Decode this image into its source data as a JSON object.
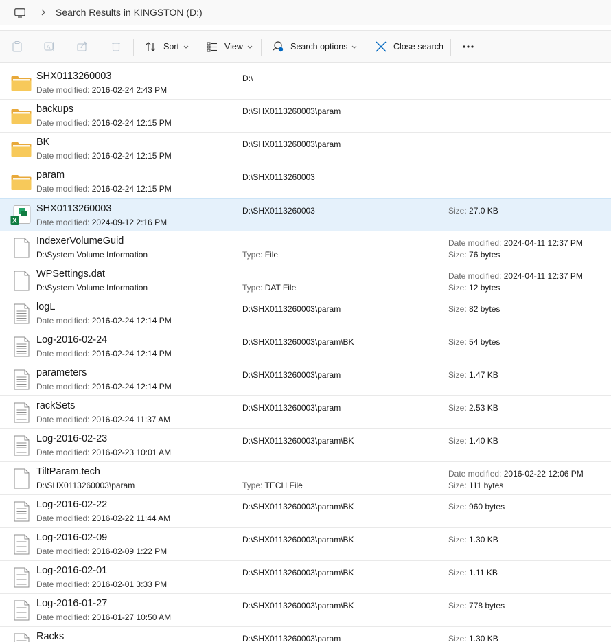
{
  "address": {
    "path": "Search Results in KINGSTON (D:)"
  },
  "toolbar": {
    "sort_label": "Sort",
    "view_label": "View",
    "search_options_label": "Search options",
    "close_search_label": "Close search",
    "more_label": "···"
  },
  "labels": {
    "date_modified": "Date modified:",
    "size": "Size:",
    "type": "Type:"
  },
  "files": [
    {
      "name": "SHX0113260003",
      "icon": "folder-icon",
      "date": "2016-02-24 2:43 PM",
      "location": "D:\\"
    },
    {
      "name": "backups",
      "icon": "folder-icon",
      "date": "2016-02-24 12:15 PM",
      "location": "D:\\SHX0113260003\\param"
    },
    {
      "name": "BK",
      "icon": "folder-icon",
      "date": "2016-02-24 12:15 PM",
      "location": "D:\\SHX0113260003\\param"
    },
    {
      "name": "param",
      "icon": "folder-icon",
      "date": "2016-02-24 12:15 PM",
      "location": "D:\\SHX0113260003"
    },
    {
      "name": "SHX0113260003",
      "icon": "excel-icon",
      "date": "2024-09-12 2:16 PM",
      "location": "D:\\SHX0113260003",
      "size": "27.0 KB",
      "selected": true
    },
    {
      "name": "IndexerVolumeGuid",
      "icon": "file-icon",
      "location": "D:\\System Volume Information",
      "type": "File",
      "date": "2024-04-11 12:37 PM",
      "size": "76 bytes"
    },
    {
      "name": "WPSettings.dat",
      "icon": "file-icon",
      "location": "D:\\System Volume Information",
      "type": "DAT File",
      "date": "2024-04-11 12:37 PM",
      "size": "12 bytes"
    },
    {
      "name": "logL",
      "icon": "text-file-icon",
      "date": "2016-02-24 12:14 PM",
      "location": "D:\\SHX0113260003\\param",
      "size": "82 bytes"
    },
    {
      "name": "Log-2016-02-24",
      "icon": "text-file-icon",
      "date": "2016-02-24 12:14 PM",
      "location": "D:\\SHX0113260003\\param\\BK",
      "size": "54 bytes"
    },
    {
      "name": "parameters",
      "icon": "text-file-icon",
      "date": "2016-02-24 12:14 PM",
      "location": "D:\\SHX0113260003\\param",
      "size": "1.47 KB"
    },
    {
      "name": "rackSets",
      "icon": "text-file-icon",
      "date": "2016-02-24 11:37 AM",
      "location": "D:\\SHX0113260003\\param",
      "size": "2.53 KB"
    },
    {
      "name": "Log-2016-02-23",
      "icon": "text-file-icon",
      "date": "2016-02-23 10:01 AM",
      "location": "D:\\SHX0113260003\\param\\BK",
      "size": "1.40 KB"
    },
    {
      "name": "TiltParam.tech",
      "icon": "file-icon",
      "location": "D:\\SHX0113260003\\param",
      "type": "TECH File",
      "date": "2016-02-22 12:06 PM",
      "size": "111 bytes"
    },
    {
      "name": "Log-2016-02-22",
      "icon": "text-file-icon",
      "date": "2016-02-22 11:44 AM",
      "location": "D:\\SHX0113260003\\param\\BK",
      "size": "960 bytes"
    },
    {
      "name": "Log-2016-02-09",
      "icon": "text-file-icon",
      "date": "2016-02-09 1:22 PM",
      "location": "D:\\SHX0113260003\\param\\BK",
      "size": "1.30 KB"
    },
    {
      "name": "Log-2016-02-01",
      "icon": "text-file-icon",
      "date": "2016-02-01 3:33 PM",
      "location": "D:\\SHX0113260003\\param\\BK",
      "size": "1.11 KB"
    },
    {
      "name": "Log-2016-01-27",
      "icon": "text-file-icon",
      "date": "2016-01-27 10:50 AM",
      "location": "D:\\SHX0113260003\\param\\BK",
      "size": "778 bytes"
    },
    {
      "name": "Racks",
      "icon": "text-file-icon",
      "location": "D:\\SHX0113260003\\param",
      "size": "1.30 KB"
    }
  ],
  "colors": {
    "selection": "#e5f1fb",
    "folder": "#f5c04a",
    "excel": "#107c41",
    "accent": "#0067c0"
  }
}
